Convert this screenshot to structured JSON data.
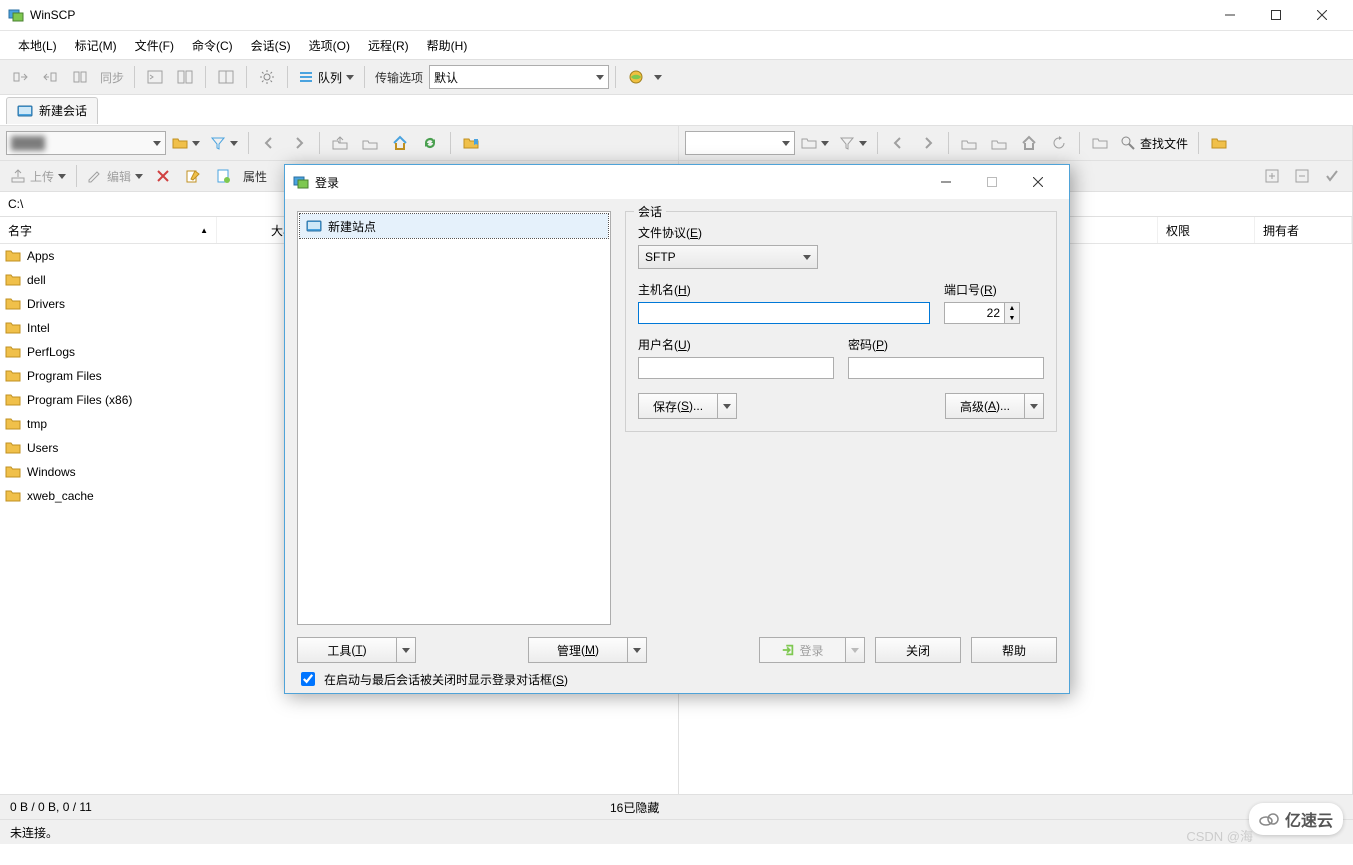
{
  "app": {
    "title": "WinSCP"
  },
  "win_controls": {
    "min": "minimize",
    "max": "maximize",
    "close": "close"
  },
  "menubar": {
    "items": [
      {
        "label": "本地(L)"
      },
      {
        "label": "标记(M)"
      },
      {
        "label": "文件(F)"
      },
      {
        "label": "命令(C)"
      },
      {
        "label": "会话(S)"
      },
      {
        "label": "选项(O)"
      },
      {
        "label": "远程(R)"
      },
      {
        "label": "帮助(H)"
      }
    ]
  },
  "toolbar1": {
    "sync_label": "同步",
    "queue_label": "队列",
    "transfer_label": "传输选项",
    "transfer_value": "默认"
  },
  "tabbar": {
    "new_session": "新建会话"
  },
  "left_panel": {
    "upload_label": "上传",
    "edit_label": "编辑",
    "props_label": "属性",
    "path": "C:\\",
    "columns": {
      "name": "名字",
      "size": "大小"
    },
    "files": [
      {
        "name": "Apps"
      },
      {
        "name": "dell"
      },
      {
        "name": "Drivers"
      },
      {
        "name": "Intel"
      },
      {
        "name": "PerfLogs"
      },
      {
        "name": "Program Files"
      },
      {
        "name": "Program Files (x86)"
      },
      {
        "name": "tmp"
      },
      {
        "name": "Users"
      },
      {
        "name": "Windows"
      },
      {
        "name": "xweb_cache"
      }
    ]
  },
  "right_panel": {
    "find_label": "查找文件",
    "columns": {
      "perm": "权限",
      "owner": "拥有者"
    }
  },
  "status": {
    "left": "0 B / 0 B,   0 / 11",
    "center": "16已隐藏",
    "bottom": "未连接。",
    "csdn": "CSDN @海"
  },
  "login_dialog": {
    "title": "登录",
    "new_site": "新建站点",
    "session_group": "会话",
    "protocol_label": "文件协议",
    "protocol_key": "E",
    "protocol_value": "SFTP",
    "host_label": "主机名",
    "host_key": "H",
    "host_value": "",
    "port_label": "端口号",
    "port_key": "R",
    "port_value": "22",
    "user_label": "用户名",
    "user_key": "U",
    "user_value": "",
    "pass_label": "密码",
    "pass_key": "P",
    "pass_value": "",
    "save_btn": "保存",
    "save_key": "S",
    "advanced_btn": "高级",
    "advanced_key": "A",
    "tools_btn": "工具",
    "tools_key": "T",
    "manage_btn": "管理",
    "manage_key": "M",
    "login_btn": "登录",
    "close_btn": "关闭",
    "help_btn": "帮助",
    "show_login_chk": "在启动与最后会话被关闭时显示登录对话框",
    "show_login_key": "S",
    "show_login_checked": true
  },
  "watermark": {
    "text": "亿速云"
  }
}
